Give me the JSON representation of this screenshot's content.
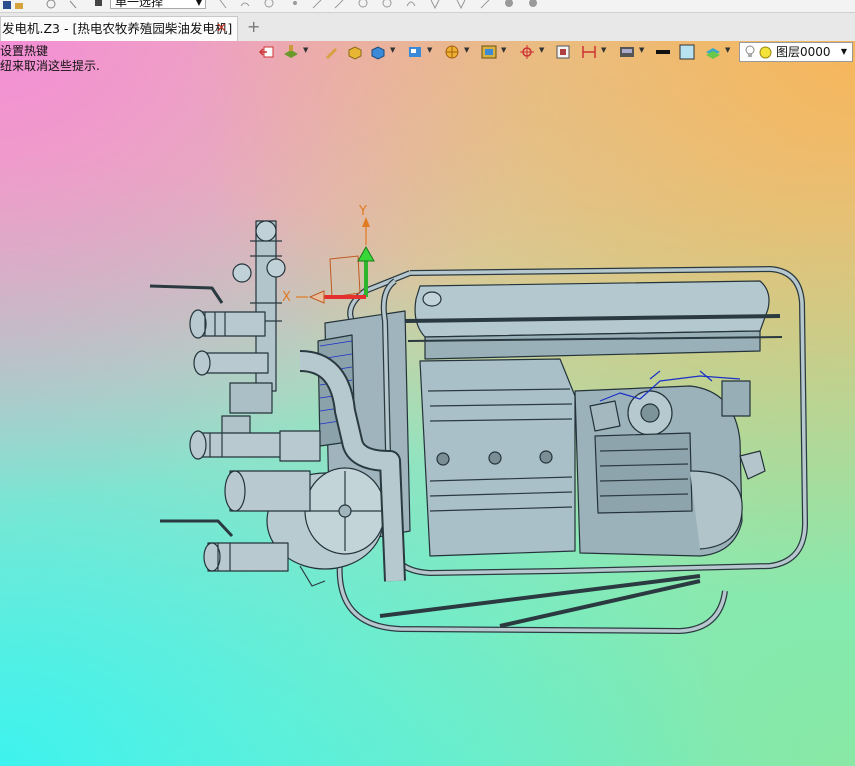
{
  "toolbar": {
    "select_mode": "单一选择",
    "icons": [
      "save-icon",
      "undo-icon",
      "redo-icon",
      "sketch-icon",
      "line-icon",
      "circle-icon",
      "arc-icon",
      "curve-icon",
      "spline-icon",
      "shell-icon"
    ]
  },
  "tab": {
    "title": "发电机.Z3 - [热电农牧养殖园柴油发电机]",
    "close_glyph": "✕",
    "add_glyph": "+"
  },
  "hint": {
    "line1": "设置热键",
    "line2": "纽来取消这些提示."
  },
  "viewport_toolbar": {
    "icons": [
      "exit-icon",
      "workplane-icon",
      "pencil-icon",
      "box-icon",
      "solid-icon",
      "view-cube-icon",
      "render-icon",
      "frame-icon",
      "center-icon",
      "section-icon",
      "dimension-icon",
      "display-icon",
      "line-style-icon",
      "color-swatch-icon",
      "layer-stack-icon"
    ],
    "layer_name": "图层0000"
  },
  "axes": {
    "x": "X",
    "y": "Y"
  },
  "colors": {
    "model": "#9fb6bf",
    "edge": "#24333a",
    "x_axis": "#e53030",
    "y_axis": "#2db52d",
    "axis_label": "#e07b22"
  }
}
